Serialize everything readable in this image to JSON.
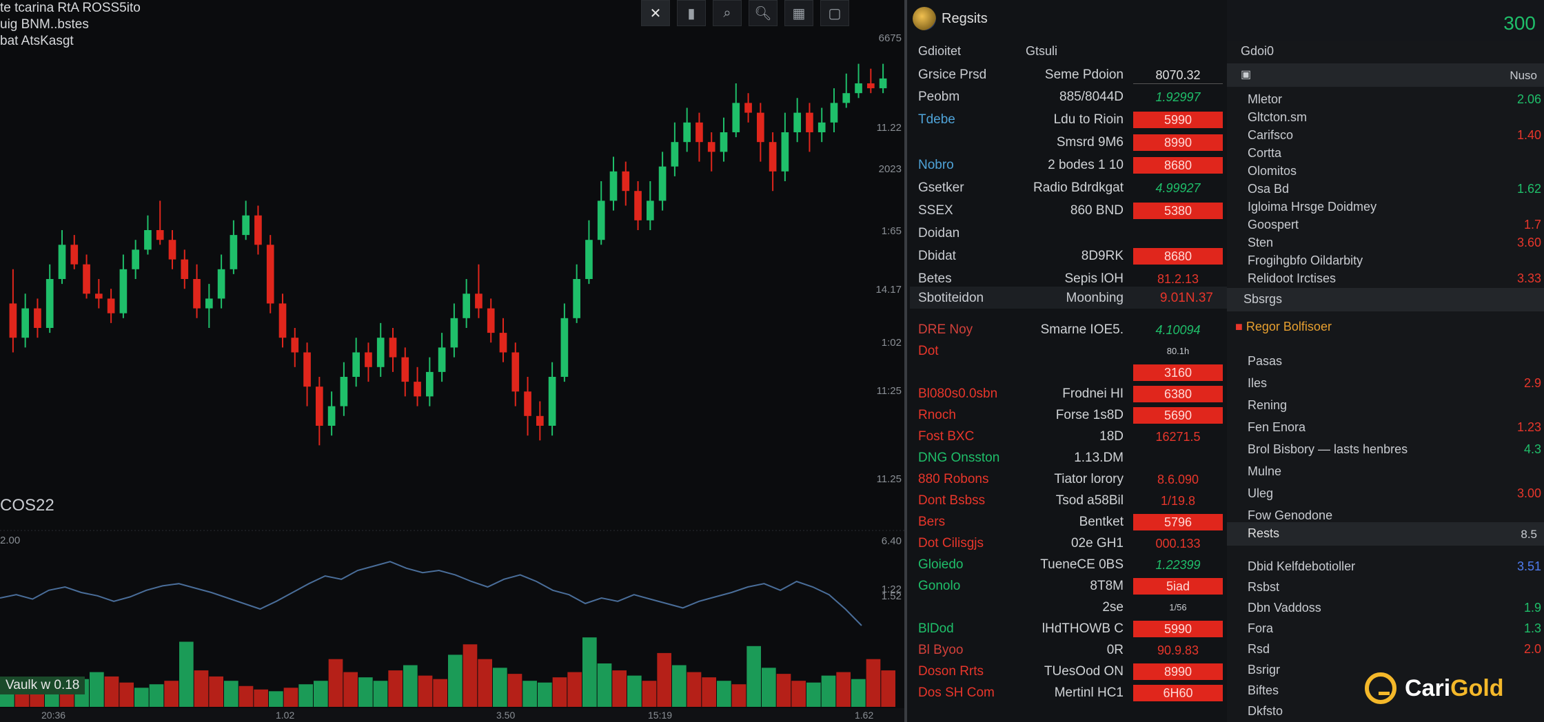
{
  "chart": {
    "info_lines": [
      "te tcarina RtA ROSS5ito",
      "uig BNM..bstes",
      "bat AtsKasgt"
    ],
    "toolbar_icons": [
      "cursor-icon",
      "trash-icon",
      "zoom-icon",
      "search-icon",
      "layout-icon",
      "window-icon"
    ],
    "price_ticks": [
      "6675",
      "11.22",
      "2023",
      "1:65",
      "14.17",
      "1:02",
      "11:25",
      "11.25",
      "1:22"
    ],
    "symbol": "COS22",
    "indicator_value": "2.00",
    "volume_label": "Vaulk w 0.18",
    "bottom_labels": [
      "20:36",
      "1.02",
      "3.50",
      "15:19",
      "1.62"
    ],
    "indicator_ticks": [
      "6.40",
      "1.52"
    ],
    "colors": {
      "up": "#1fbf6a",
      "down": "#e0261c",
      "line": "#4a6e9a"
    }
  },
  "chart_data": {
    "type": "candlestick",
    "candles": [
      [
        0.45,
        0.38,
        0.52,
        0.35
      ],
      [
        0.38,
        0.44,
        0.47,
        0.36
      ],
      [
        0.44,
        0.4,
        0.46,
        0.38
      ],
      [
        0.4,
        0.5,
        0.53,
        0.39
      ],
      [
        0.5,
        0.57,
        0.6,
        0.49
      ],
      [
        0.57,
        0.53,
        0.59,
        0.52
      ],
      [
        0.53,
        0.47,
        0.55,
        0.46
      ],
      [
        0.47,
        0.46,
        0.5,
        0.44
      ],
      [
        0.46,
        0.43,
        0.48,
        0.41
      ],
      [
        0.43,
        0.52,
        0.55,
        0.42
      ],
      [
        0.52,
        0.56,
        0.58,
        0.5
      ],
      [
        0.56,
        0.6,
        0.63,
        0.55
      ],
      [
        0.6,
        0.58,
        0.66,
        0.57
      ],
      [
        0.58,
        0.54,
        0.6,
        0.52
      ],
      [
        0.54,
        0.5,
        0.56,
        0.48
      ],
      [
        0.5,
        0.44,
        0.53,
        0.42
      ],
      [
        0.44,
        0.46,
        0.49,
        0.4
      ],
      [
        0.46,
        0.52,
        0.55,
        0.44
      ],
      [
        0.52,
        0.59,
        0.62,
        0.51
      ],
      [
        0.59,
        0.63,
        0.66,
        0.58
      ],
      [
        0.63,
        0.57,
        0.65,
        0.55
      ],
      [
        0.57,
        0.45,
        0.59,
        0.43
      ],
      [
        0.45,
        0.38,
        0.47,
        0.36
      ],
      [
        0.38,
        0.35,
        0.4,
        0.32
      ],
      [
        0.35,
        0.28,
        0.37,
        0.24
      ],
      [
        0.28,
        0.2,
        0.3,
        0.16
      ],
      [
        0.2,
        0.24,
        0.27,
        0.18
      ],
      [
        0.24,
        0.3,
        0.33,
        0.22
      ],
      [
        0.3,
        0.35,
        0.38,
        0.28
      ],
      [
        0.35,
        0.32,
        0.37,
        0.29
      ],
      [
        0.32,
        0.38,
        0.41,
        0.3
      ],
      [
        0.38,
        0.34,
        0.4,
        0.31
      ],
      [
        0.34,
        0.29,
        0.36,
        0.26
      ],
      [
        0.29,
        0.26,
        0.32,
        0.24
      ],
      [
        0.26,
        0.31,
        0.34,
        0.24
      ],
      [
        0.31,
        0.36,
        0.39,
        0.29
      ],
      [
        0.36,
        0.42,
        0.45,
        0.34
      ],
      [
        0.42,
        0.47,
        0.5,
        0.4
      ],
      [
        0.47,
        0.44,
        0.53,
        0.42
      ],
      [
        0.44,
        0.39,
        0.46,
        0.37
      ],
      [
        0.39,
        0.35,
        0.42,
        0.33
      ],
      [
        0.35,
        0.27,
        0.37,
        0.24
      ],
      [
        0.27,
        0.22,
        0.3,
        0.18
      ],
      [
        0.22,
        0.2,
        0.25,
        0.17
      ],
      [
        0.2,
        0.3,
        0.33,
        0.18
      ],
      [
        0.3,
        0.42,
        0.45,
        0.29
      ],
      [
        0.42,
        0.5,
        0.53,
        0.41
      ],
      [
        0.5,
        0.58,
        0.62,
        0.49
      ],
      [
        0.58,
        0.66,
        0.7,
        0.57
      ],
      [
        0.66,
        0.72,
        0.75,
        0.64
      ],
      [
        0.72,
        0.68,
        0.74,
        0.65
      ],
      [
        0.68,
        0.62,
        0.7,
        0.6
      ],
      [
        0.62,
        0.66,
        0.7,
        0.6
      ],
      [
        0.66,
        0.73,
        0.76,
        0.64
      ],
      [
        0.73,
        0.78,
        0.82,
        0.71
      ],
      [
        0.78,
        0.82,
        0.85,
        0.76
      ],
      [
        0.82,
        0.78,
        0.84,
        0.74
      ],
      [
        0.78,
        0.76,
        0.8,
        0.72
      ],
      [
        0.76,
        0.8,
        0.83,
        0.74
      ],
      [
        0.8,
        0.86,
        0.9,
        0.79
      ],
      [
        0.86,
        0.84,
        0.88,
        0.82
      ],
      [
        0.84,
        0.78,
        0.86,
        0.74
      ],
      [
        0.78,
        0.72,
        0.8,
        0.68
      ],
      [
        0.72,
        0.8,
        0.84,
        0.7
      ],
      [
        0.8,
        0.84,
        0.87,
        0.78
      ],
      [
        0.84,
        0.8,
        0.86,
        0.76
      ],
      [
        0.8,
        0.82,
        0.85,
        0.78
      ],
      [
        0.82,
        0.86,
        0.89,
        0.8
      ],
      [
        0.86,
        0.88,
        0.92,
        0.85
      ],
      [
        0.88,
        0.9,
        0.94,
        0.87
      ],
      [
        0.9,
        0.89,
        0.93,
        0.88
      ],
      [
        0.89,
        0.91,
        0.94,
        0.88
      ]
    ],
    "indicator": [
      0.45,
      0.48,
      0.44,
      0.52,
      0.55,
      0.5,
      0.47,
      0.42,
      0.46,
      0.52,
      0.56,
      0.58,
      0.54,
      0.5,
      0.45,
      0.4,
      0.35,
      0.42,
      0.5,
      0.58,
      0.65,
      0.62,
      0.7,
      0.74,
      0.78,
      0.72,
      0.68,
      0.7,
      0.66,
      0.6,
      0.55,
      0.62,
      0.66,
      0.6,
      0.52,
      0.48,
      0.4,
      0.45,
      0.42,
      0.48,
      0.44,
      0.4,
      0.36,
      0.42,
      0.46,
      0.5,
      0.55,
      0.58,
      0.52,
      0.6,
      0.55,
      0.48,
      0.35,
      0.2
    ],
    "volume": [
      0.3,
      0.22,
      0.28,
      0.18,
      0.25,
      0.32,
      0.4,
      0.35,
      0.28,
      0.22,
      0.26,
      0.3,
      0.75,
      0.42,
      0.35,
      0.3,
      0.24,
      0.2,
      0.18,
      0.22,
      0.26,
      0.3,
      0.55,
      0.4,
      0.34,
      0.3,
      0.42,
      0.48,
      0.36,
      0.32,
      0.6,
      0.72,
      0.55,
      0.45,
      0.38,
      0.3,
      0.28,
      0.34,
      0.4,
      0.8,
      0.5,
      0.42,
      0.36,
      0.3,
      0.62,
      0.48,
      0.4,
      0.34,
      0.3,
      0.26,
      0.7,
      0.45,
      0.38,
      0.3,
      0.28,
      0.36,
      0.4,
      0.32,
      0.55,
      0.42
    ]
  },
  "book": {
    "title": "Regsits",
    "tab_left": "Gdioitet",
    "tab_mid": "Gtsuli",
    "header": {
      "c1": "Grsice Prsd",
      "c2": "Seme Pdoion",
      "c3": "8070.32"
    },
    "rows_a": [
      {
        "c1": "Peobm",
        "c1_color": "normal",
        "c2": "885/8044D",
        "c3": "1.92997",
        "c3_style": "green"
      },
      {
        "c1": "Tdebe",
        "c1_color": "blue",
        "c2": "Ldu to Rioin",
        "c3": "5990",
        "c3_style": "red"
      },
      {
        "c1": "",
        "c1_color": "normal",
        "c2": "Smsrd 9M6",
        "c3": "8990",
        "c3_style": "red"
      },
      {
        "c1": "Nobro",
        "c1_color": "blue",
        "c2": "2 bodes 1 10",
        "c3": "8680",
        "c3_style": "red"
      },
      {
        "c1": "Gsetker",
        "c1_color": "normal",
        "c2": "Radio Bdrdkgat",
        "c3": "4.99927",
        "c3_style": "green"
      },
      {
        "c1": "SSEX",
        "c1_color": "normal",
        "c2": "860 BND",
        "c3": "5380",
        "c3_style": "red"
      },
      {
        "c1": "Doidan",
        "c1_color": "normal",
        "c2": "",
        "c3": "",
        "c3_style": "none"
      },
      {
        "c1": "Dbidat",
        "c1_color": "normal",
        "c2": "8D9RK",
        "c3": "8680",
        "c3_style": "red"
      },
      {
        "c1": "Betes",
        "c1_color": "normal",
        "c2": "Sepis lOH",
        "c3": "81.2.13",
        "c3_style": "redtext"
      }
    ],
    "section2": {
      "c1": "Sbotiteidon",
      "c2": "Moonbing",
      "c3": "9.01N.37"
    },
    "rows_b": [
      {
        "c1": "DRE Noy",
        "c1_color": "mixed",
        "c2": "Smarne IOE5.",
        "c3": "4.10094",
        "c3_style": "green"
      },
      {
        "c1": "Dot",
        "c1_color": "red",
        "c2": "",
        "c3": "80.1h",
        "c3_style": "small"
      },
      {
        "c1": "",
        "c1_color": "normal",
        "c2": "",
        "c3": "3160",
        "c3_style": "red"
      },
      {
        "c1": "Bl080s0.0sbn",
        "c1_color": "red",
        "c2": "Frodnei HI",
        "c3": "6380",
        "c3_style": "red"
      },
      {
        "c1": "Rnoch",
        "c1_color": "red",
        "c2": "Forse 1s8D",
        "c3": "5690",
        "c3_style": "red"
      },
      {
        "c1": "Fost BXC",
        "c1_color": "red",
        "c2": "18D",
        "c3": "16271.5",
        "c3_style": "redtext"
      },
      {
        "c1": "DNG Onsston",
        "c1_color": "green",
        "c2": "1.13.DM",
        "c3": "",
        "c3_style": "none"
      },
      {
        "c1": "880 Robons",
        "c1_color": "red",
        "c2": "Tiator lorory",
        "c3": "8.6.090",
        "c3_style": "redtext"
      },
      {
        "c1": "Dont Bsbss",
        "c1_color": "red",
        "c2": "Tsod a58Bil",
        "c3": "1/19.8",
        "c3_style": "redtext"
      },
      {
        "c1": "Bers",
        "c1_color": "red",
        "c2": "Bentket",
        "c3": "5796",
        "c3_style": "red"
      },
      {
        "c1": "Dot Cilisgjs",
        "c1_color": "red",
        "c2": "02e GH1",
        "c3": "000.133",
        "c3_style": "redtext"
      },
      {
        "c1": "Gloiedo",
        "c1_color": "green",
        "c2": "TueneCE 0BS",
        "c3": "1.22399",
        "c3_style": "green"
      },
      {
        "c1": "Gonolo",
        "c1_color": "green",
        "c2": "8T8M",
        "c3": "5iad",
        "c3_style": "red"
      },
      {
        "c1": "",
        "c1_color": "normal",
        "c2": "2se",
        "c3": "1/56",
        "c3_style": "small"
      },
      {
        "c1": "BlDod",
        "c1_color": "green",
        "c2": "lHdTHOWB C",
        "c3": "5990",
        "c3_style": "red"
      },
      {
        "c1": "Bl Byoo",
        "c1_color": "mixed",
        "c2": "0R",
        "c3": "90.9.83",
        "c3_style": "redtext"
      },
      {
        "c1": "Doson Rrts",
        "c1_color": "red",
        "c2": "TUesOod ON",
        "c3": "8990",
        "c3_style": "red"
      },
      {
        "c1": "Dos SH Com",
        "c1_color": "red",
        "c2": "Mertinl HC1",
        "c3": "6H60",
        "c3_style": "red"
      }
    ]
  },
  "right": {
    "top_value": "300",
    "top_label": "Gdoi0",
    "sub_label": "Nuso",
    "items_a": [
      {
        "label": "Mletor",
        "value": "2.06",
        "color": "#1fbf6a"
      },
      {
        "label": "Gltcton.sm",
        "value": "",
        "color": "#1fbf6a"
      },
      {
        "label": "Carifsco",
        "value": "1.40",
        "color": "#e8362b"
      },
      {
        "label": "Cortta",
        "value": "",
        "color": "#1fbf6a"
      },
      {
        "label": "Olomitos",
        "value": "",
        "color": "#1fbf6a"
      },
      {
        "label": "Osa Bd",
        "value": "1.62",
        "color": "#1fbf6a"
      },
      {
        "label": "Igloima Hrsge Doidmey",
        "value": "",
        "color": "#1fbf6a"
      },
      {
        "label": "Goospert",
        "value": "1.7",
        "color": "#e8362b"
      },
      {
        "label": "Sten",
        "value": "3.60",
        "color": "#e8362b"
      },
      {
        "label": "Frogihgbfo Oildarbity",
        "value": "",
        "color": "#e8362b"
      },
      {
        "label": "Relidoot Irctises",
        "value": "3.33",
        "color": "#e8362b"
      }
    ],
    "section": "Sbsrgs",
    "section_item": "Regor Bolfisoer",
    "items_b": [
      {
        "label": "Pasas",
        "value": "",
        "color": "#e8362b"
      },
      {
        "label": "Iles",
        "value": "2.9",
        "color": "#e8362b"
      },
      {
        "label": "Rening",
        "value": "",
        "color": "#1fbf6a"
      },
      {
        "label": "Fen Enora",
        "value": "1.23",
        "color": "#e8362b"
      },
      {
        "label": "Brol Bisbory — lasts henbres",
        "value": "4.3",
        "color": "#1fbf6a"
      },
      {
        "label": "Mulne",
        "value": "",
        "color": "#1fbf6a"
      },
      {
        "label": "Uleg",
        "value": "3.00",
        "color": "#e8362b"
      },
      {
        "label": "Fow Genodone",
        "value": "",
        "color": "#1fbf6a"
      }
    ],
    "section2": "Rests",
    "section2_value": "8.5",
    "items_c": [
      {
        "label": "Dbid Kelfdebotioller",
        "value": "3.51",
        "color": "#4f7cf0"
      },
      {
        "label": "Rsbst",
        "value": "",
        "color": "#1fbf6a"
      },
      {
        "label": "Dbn Vaddoss",
        "value": "1.9",
        "color": "#1fbf6a"
      },
      {
        "label": "Fora",
        "value": "1.3",
        "color": "#1fbf6a"
      },
      {
        "label": "Rsd",
        "value": "2.0",
        "color": "#e8362b"
      },
      {
        "label": "Bsrigr",
        "value": "",
        "color": "#1fbf6a"
      },
      {
        "label": "Biftes",
        "value": "",
        "color": "#1fbf6a"
      },
      {
        "label": "Dkfsto",
        "value": "",
        "color": "#1fbf6a"
      }
    ]
  },
  "brand": {
    "part1": "Cari",
    "part2": "Gold"
  }
}
